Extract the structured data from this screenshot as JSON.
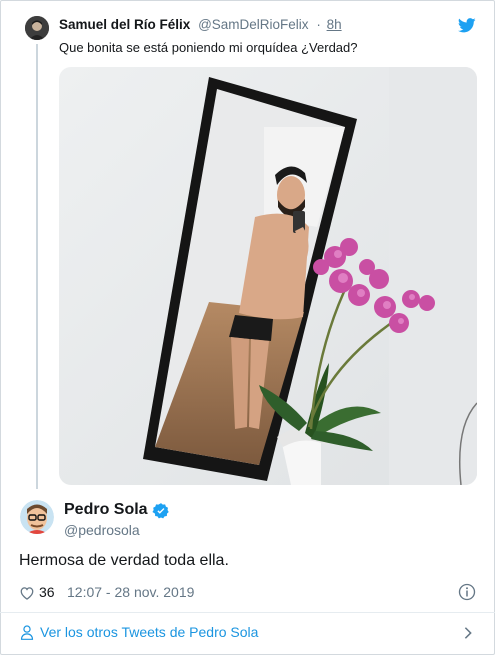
{
  "parent_tweet": {
    "author_name": "Samuel del Río Félix",
    "author_handle": "@SamDelRioFelix",
    "separator": "·",
    "time": "8h",
    "text": "Que bonita se está poniendo mi orquídea ¿Verdad?"
  },
  "main_tweet": {
    "author_name": "Pedro Sola",
    "author_handle": "@pedrosola",
    "text": "Hermosa de verdad toda ella.",
    "like_count": "36",
    "timestamp": "12:07 - 28 nov. 2019"
  },
  "footer": {
    "link_text": "Ver los otros Tweets de Pedro Sola"
  },
  "icons": {
    "brand": "twitter-bird-icon",
    "verified": "verified-badge-icon",
    "like": "heart-icon",
    "info": "info-icon",
    "profile": "user-icon",
    "more": "chevron-right-icon"
  },
  "colors": {
    "twitter_blue": "#1da1f2",
    "link_blue": "#1b95e0",
    "muted_gray": "#657786",
    "text_dark": "#14171a",
    "orchid_pink": "#c94fa3"
  }
}
